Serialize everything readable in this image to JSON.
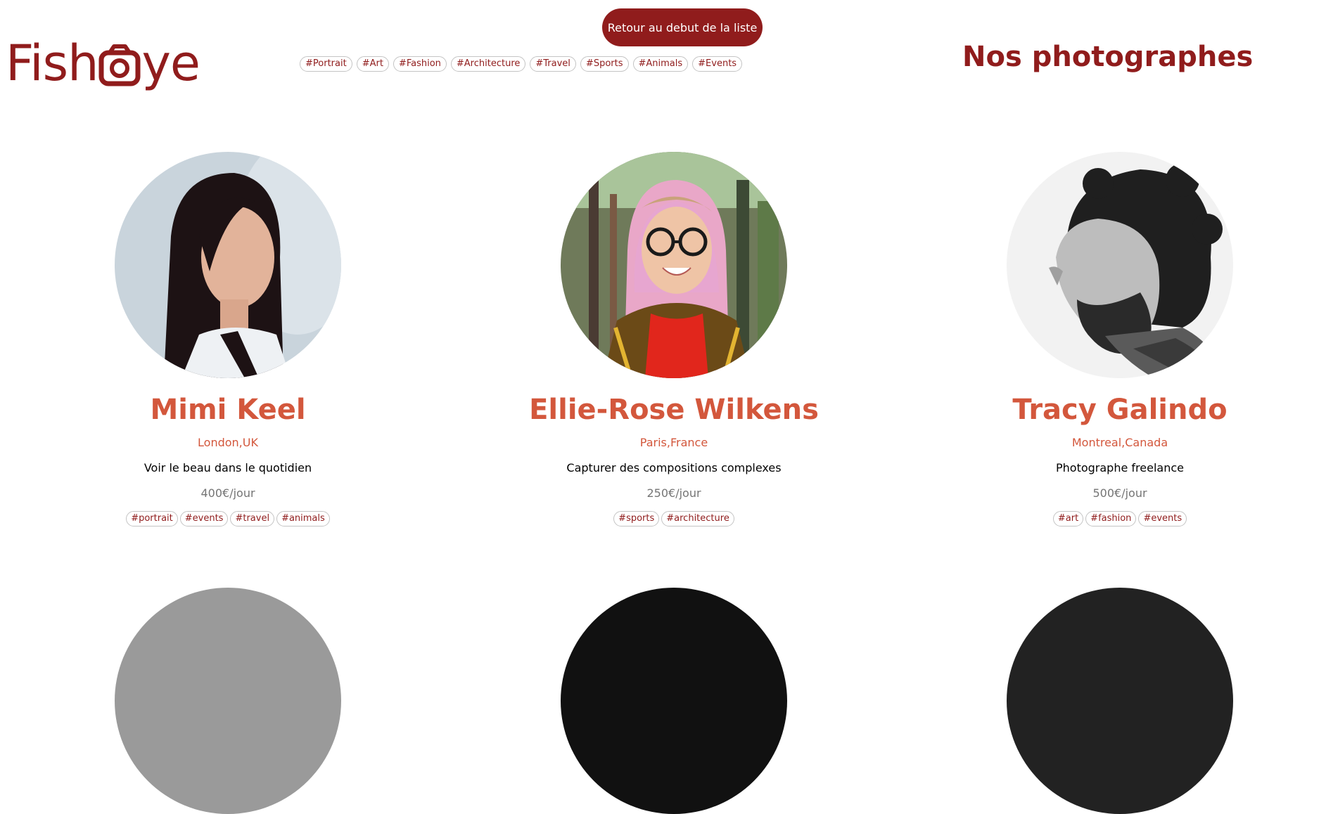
{
  "header": {
    "logo_text_left": "Fish",
    "logo_text_right": "ye",
    "back_button_label": "Retour au debut de la liste",
    "page_title": "Nos photographes",
    "brand_color": "#901C1C",
    "nav_tags": [
      "#Portrait",
      "#Art",
      "#Fashion",
      "#Architecture",
      "#Travel",
      "#Sports",
      "#Animals",
      "#Events"
    ]
  },
  "photographers": [
    {
      "name": "Mimi Keel",
      "location": "London,UK",
      "tagline": "Voir le beau dans le quotidien",
      "price": "400€/jour",
      "tags": [
        "#portrait",
        "#events",
        "#travel",
        "#animals"
      ]
    },
    {
      "name": "Ellie-Rose Wilkens",
      "location": "Paris,France",
      "tagline": "Capturer des compositions complexes",
      "price": "250€/jour",
      "tags": [
        "#sports",
        "#architecture"
      ]
    },
    {
      "name": "Tracy Galindo",
      "location": "Montreal,Canada",
      "tagline": "Photographe freelance",
      "price": "500€/jour",
      "tags": [
        "#art",
        "#fashion",
        "#events"
      ]
    }
  ],
  "colors": {
    "name_accent": "#D3573C",
    "price_grey": "#757575"
  }
}
